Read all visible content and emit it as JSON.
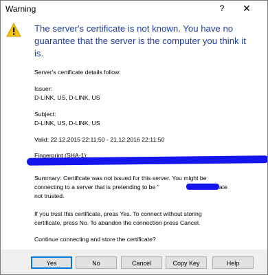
{
  "window": {
    "title": "Warning",
    "help_glyph": "?",
    "close_glyph": "✕"
  },
  "icons": {
    "warning": "warning-icon",
    "warning_color": "#f2c200"
  },
  "heading": [
    "The server's certificate is not known. You have no",
    "guarantee that the server is the computer you think it",
    "is."
  ],
  "details": {
    "intro": "Server's certificate details follow:",
    "issuer_label": "Issuer:",
    "issuer_value": "D-LINK, US, D-LINK, US",
    "subject_label": "Subject:",
    "subject_value": "D-LINK, US, D-LINK, US",
    "valid": "Valid: 22.12.2015 22:11:50 - 21.12.2016 22:11:50",
    "fingerprint_label": "Fingerprint (SHA-1):"
  },
  "summary": [
    "Summary: Certificate was not issued for this server. You might be",
    "connecting to a server that is pretending to be \"",
    "\". Certificate",
    "not trusted."
  ],
  "instructions": [
    "If you trust this certificate, press Yes. To connect without storing",
    "certificate, press No. To abandon the connection press Cancel."
  ],
  "question": "Continue connecting and store the certificate?",
  "buttons": {
    "yes": "Yes",
    "no": "No",
    "cancel": "Cancel",
    "copy_key": "Copy Key",
    "help": "Help"
  }
}
